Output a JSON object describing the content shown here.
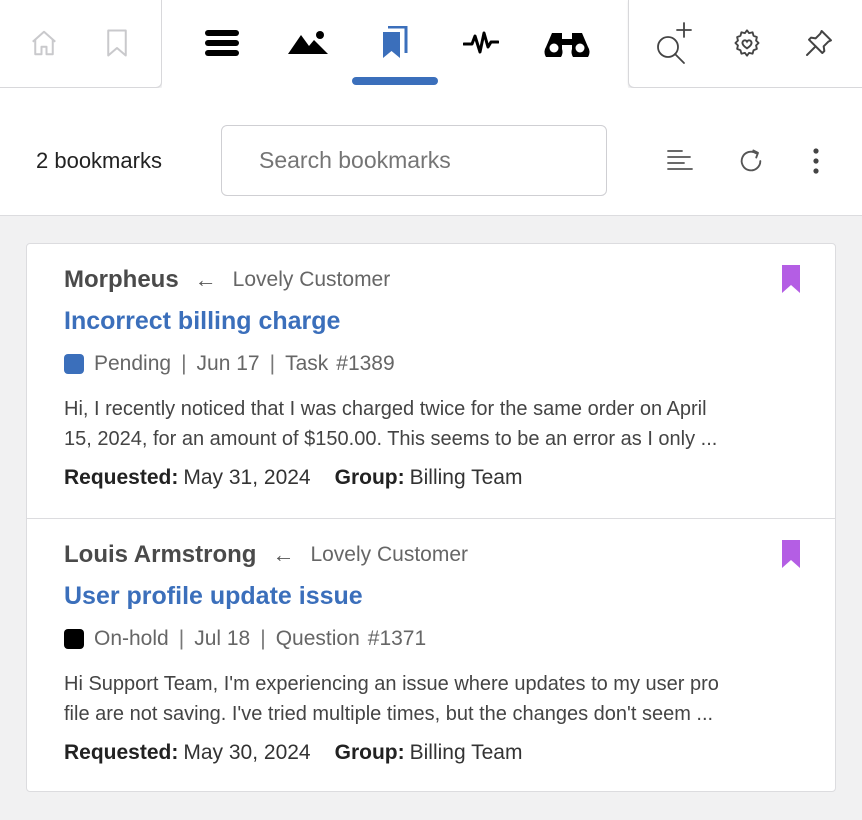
{
  "toolbar": {
    "left": [
      {
        "name": "home-icon"
      },
      {
        "name": "bookmark-outline-icon"
      }
    ],
    "middle": [
      {
        "name": "menu-icon"
      },
      {
        "name": "mountain-image-icon"
      },
      {
        "name": "bookmarks-icon",
        "active": true
      },
      {
        "name": "activity-pulse-icon"
      },
      {
        "name": "binoculars-icon"
      }
    ],
    "right": [
      {
        "name": "search-add-icon"
      },
      {
        "name": "gear-icon"
      },
      {
        "name": "pin-icon"
      }
    ]
  },
  "colors": {
    "accent": "#3b6fbb",
    "bookmark": "#b45ee4",
    "pending": "#3b6fbb",
    "onhold": "#000000"
  },
  "header": {
    "count": "2 bookmarks",
    "search_placeholder": "Search bookmarks",
    "tools": [
      "align-left-icon",
      "refresh-icon",
      "more-vertical-icon"
    ]
  },
  "bookmarks": [
    {
      "requester": "Morpheus",
      "arrow": "←",
      "customer": "Lovely Customer",
      "title": "Incorrect billing charge",
      "status": "Pending",
      "date": "Jun 17",
      "type": "Task",
      "id": "#1389",
      "excerpt_line1": "Hi, I recently noticed that I was charged twice for the same order on April",
      "excerpt_line2": "15, 2024, for an amount of $150.00. This seems to be an error as I only ...",
      "requested_label": "Requested:",
      "requested": "May 31, 2024",
      "group_label": "Group:",
      "group": "Billing Team"
    },
    {
      "requester": "Louis Armstrong",
      "arrow": "←",
      "customer": "Lovely Customer",
      "title": "User profile update issue",
      "status": "On-hold",
      "date": "Jul 18",
      "type": "Question",
      "id": "#1371",
      "excerpt_line1": "Hi Support Team, I'm experiencing an issue where updates to my user pro",
      "excerpt_line2": "file are not saving. I've tried multiple times, but the changes don't seem ...",
      "requested_label": "Requested:",
      "requested": "May 30, 2024",
      "group_label": "Group:",
      "group": "Billing Team"
    }
  ],
  "separator": "|"
}
